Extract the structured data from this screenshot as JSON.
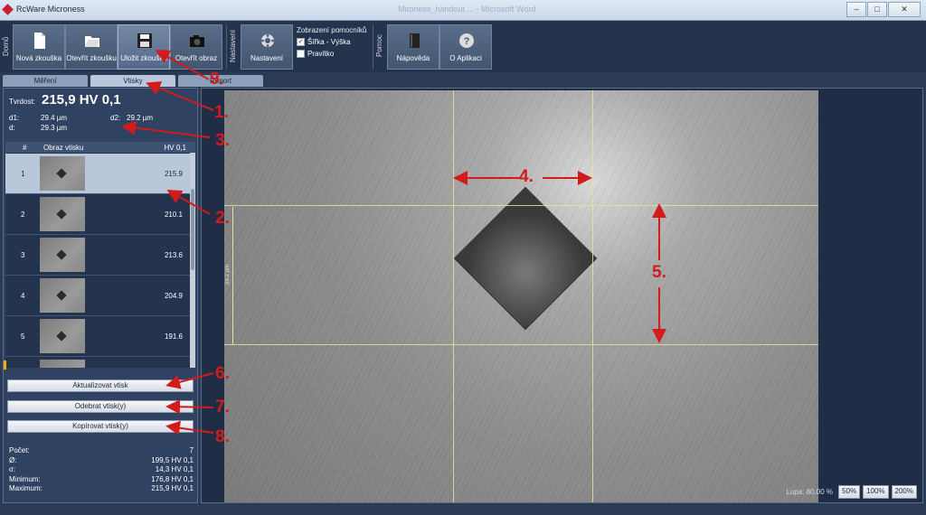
{
  "window": {
    "title": "RcWare Microness",
    "background_title": "Mironess_handout ... - Microsoft Word",
    "buttons": [
      "–",
      "□",
      "✕"
    ]
  },
  "ribbon": {
    "group_home": "Domů",
    "group_settings": "Nastavení",
    "group_help": "Pomoc",
    "buttons": [
      {
        "label": "Nová zkouška",
        "icon": "new-document-icon"
      },
      {
        "label": "Otevřít zkoušku",
        "icon": "open-folder-icon"
      },
      {
        "label": "Uložit zkoušku",
        "icon": "save-disk-icon"
      },
      {
        "label": "Otevřít obraz",
        "icon": "camera-icon"
      },
      {
        "label": "Nastavení",
        "icon": "gear-icon"
      },
      {
        "label": "Nápověda",
        "icon": "book-icon"
      },
      {
        "label": "O Aplikaci",
        "icon": "question-icon"
      }
    ],
    "helpers": {
      "title": "Zobrazení pomocníků",
      "options": [
        {
          "label": "Šířka - Výška",
          "checked": true
        },
        {
          "label": "Pravítko",
          "checked": false
        }
      ]
    }
  },
  "tabs": [
    "Měření",
    "Vtisky",
    "Report"
  ],
  "active_tab": "Vtisky",
  "measurement": {
    "hardness_label": "Tvrdost:",
    "hardness_value": "215,9 HV 0,1",
    "d1_label": "d1:",
    "d1_value": "29.4 µm",
    "d2_label": "d2:",
    "d2_value": "29.2 µm",
    "d_label": "d:",
    "d_value": "29.3 µm"
  },
  "table": {
    "headers": [
      "#",
      "Obraz vtisku",
      "HV 0,1"
    ],
    "rows": [
      {
        "num": "1",
        "hv": "215.9",
        "selected": true
      },
      {
        "num": "2",
        "hv": "210.1",
        "selected": false
      },
      {
        "num": "3",
        "hv": "213.6",
        "selected": false
      },
      {
        "num": "4",
        "hv": "204.9",
        "selected": false
      },
      {
        "num": "5",
        "hv": "191.6",
        "selected": false
      }
    ]
  },
  "actions": {
    "update": "Aktualizovat vtisk",
    "remove": "Odebrat vtisk(y)",
    "copy": "Kopírovat vtisk(y)"
  },
  "stats": [
    {
      "label": "Počet:",
      "value": "7"
    },
    {
      "label": "Ø:",
      "value": "199,5 HV 0,1"
    },
    {
      "label": "σ:",
      "value": "14,3 HV 0,1"
    },
    {
      "label": "Minimum:",
      "value": "176,8 HV 0,1"
    },
    {
      "label": "Maximum:",
      "value": "215,9 HV 0,1"
    }
  ],
  "viewer": {
    "ruler_label": "29.2 µm",
    "zoom_label": "Lupa: 80.00 %",
    "zoom_buttons": [
      "50%",
      "100%",
      "200%"
    ]
  },
  "annotations": [
    "1.",
    "2.",
    "3.",
    "4.",
    "5.",
    "6.",
    "7.",
    "8.",
    "9."
  ],
  "colors": {
    "background": "#2b3b55",
    "annotation": "#d41b1b",
    "selection": "#b8c7da",
    "guide_line": "#e9dfa0"
  }
}
